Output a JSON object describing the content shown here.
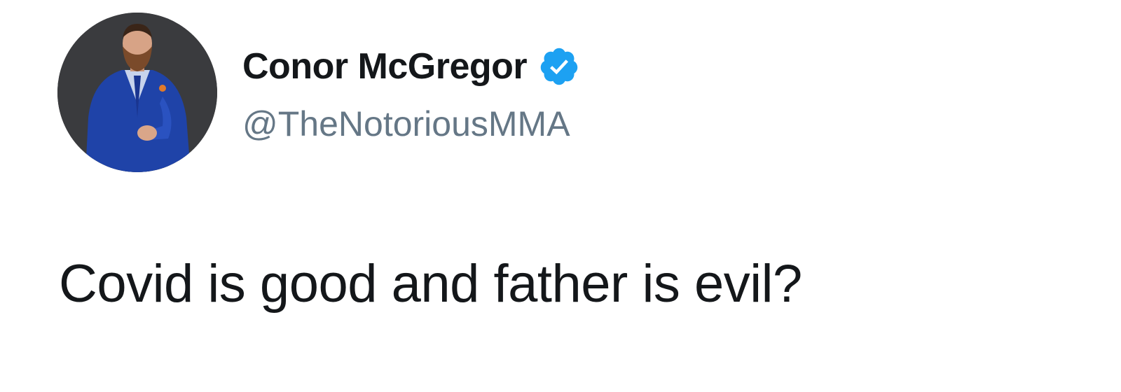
{
  "tweet": {
    "author": {
      "display_name": "Conor McGregor",
      "handle": "@TheNotoriousMMA",
      "verified": true,
      "avatar_icon": "profile-photo",
      "verified_icon": "verified-badge-icon"
    },
    "text": "Covid is good and father is evil?"
  },
  "colors": {
    "name_text": "#14171a",
    "handle_text": "#657786",
    "verified_badge": "#1da1f2",
    "background": "#ffffff"
  }
}
